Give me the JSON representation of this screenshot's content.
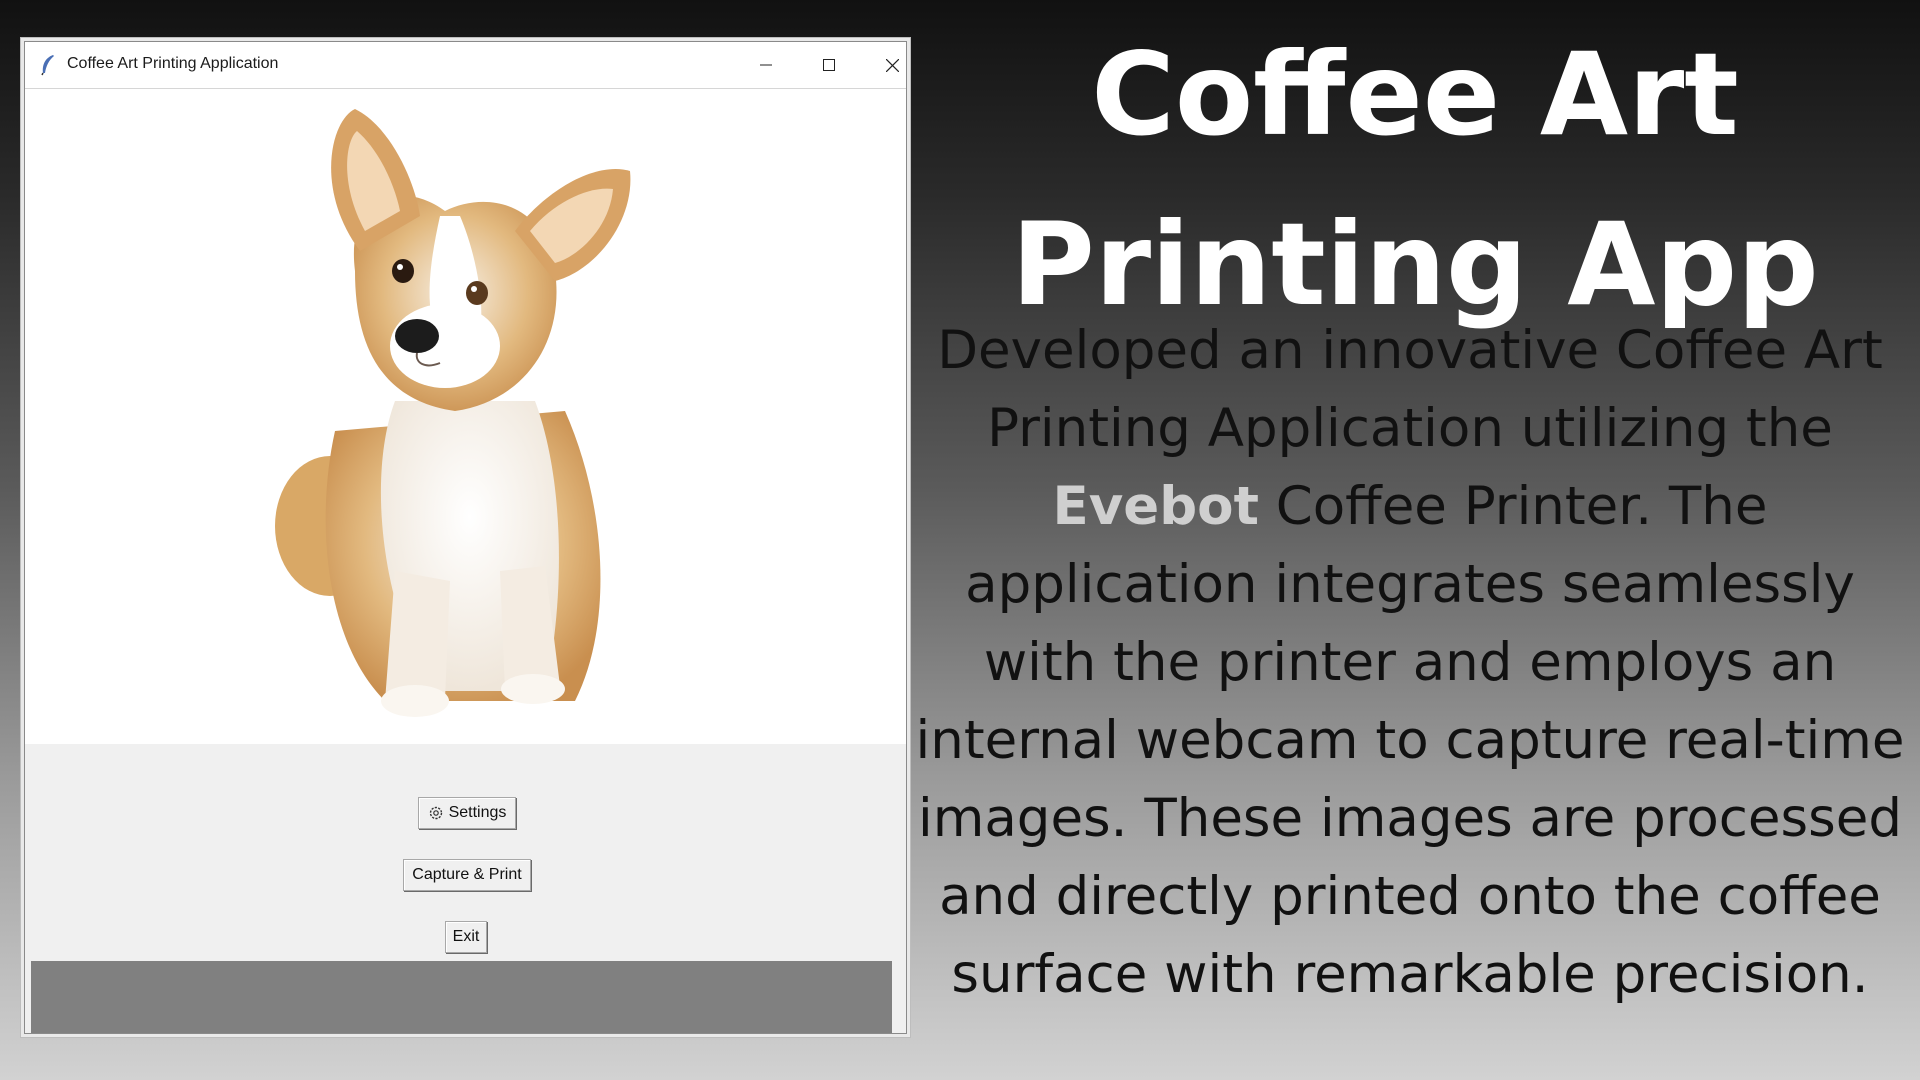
{
  "window": {
    "title": "Coffee Art Printing Application",
    "icon": "feather-icon",
    "controls": [
      "minimize-icon",
      "maximize-icon",
      "close-icon"
    ]
  },
  "canvas": {
    "image_content": "corgi dog photo"
  },
  "buttons": {
    "settings_label": "Settings",
    "settings_icon": "gear-icon",
    "capture_label": "Capture & Print",
    "exit_label": "Exit"
  },
  "status_bar": {
    "text": ""
  },
  "headline": {
    "line1": "Coffee Art",
    "line2": "Printing App"
  },
  "description": {
    "part1": "Developed an innovative Coffee Art Printing Application utilizing the ",
    "highlight": "Evebot",
    "part2": " Coffee Printer. The application integrates seamlessly with the printer and employs an internal webcam to capture real-time images. These images are processed and directly printed onto the coffee surface with remarkable precision."
  },
  "colors": {
    "background_top": "#111111",
    "background_bottom": "#d2d2d2",
    "headline": "#ffffff",
    "body_text": "#111111",
    "highlight": "#cfcfcf",
    "status_bar": "#808080",
    "panel": "#f0f0f0"
  }
}
